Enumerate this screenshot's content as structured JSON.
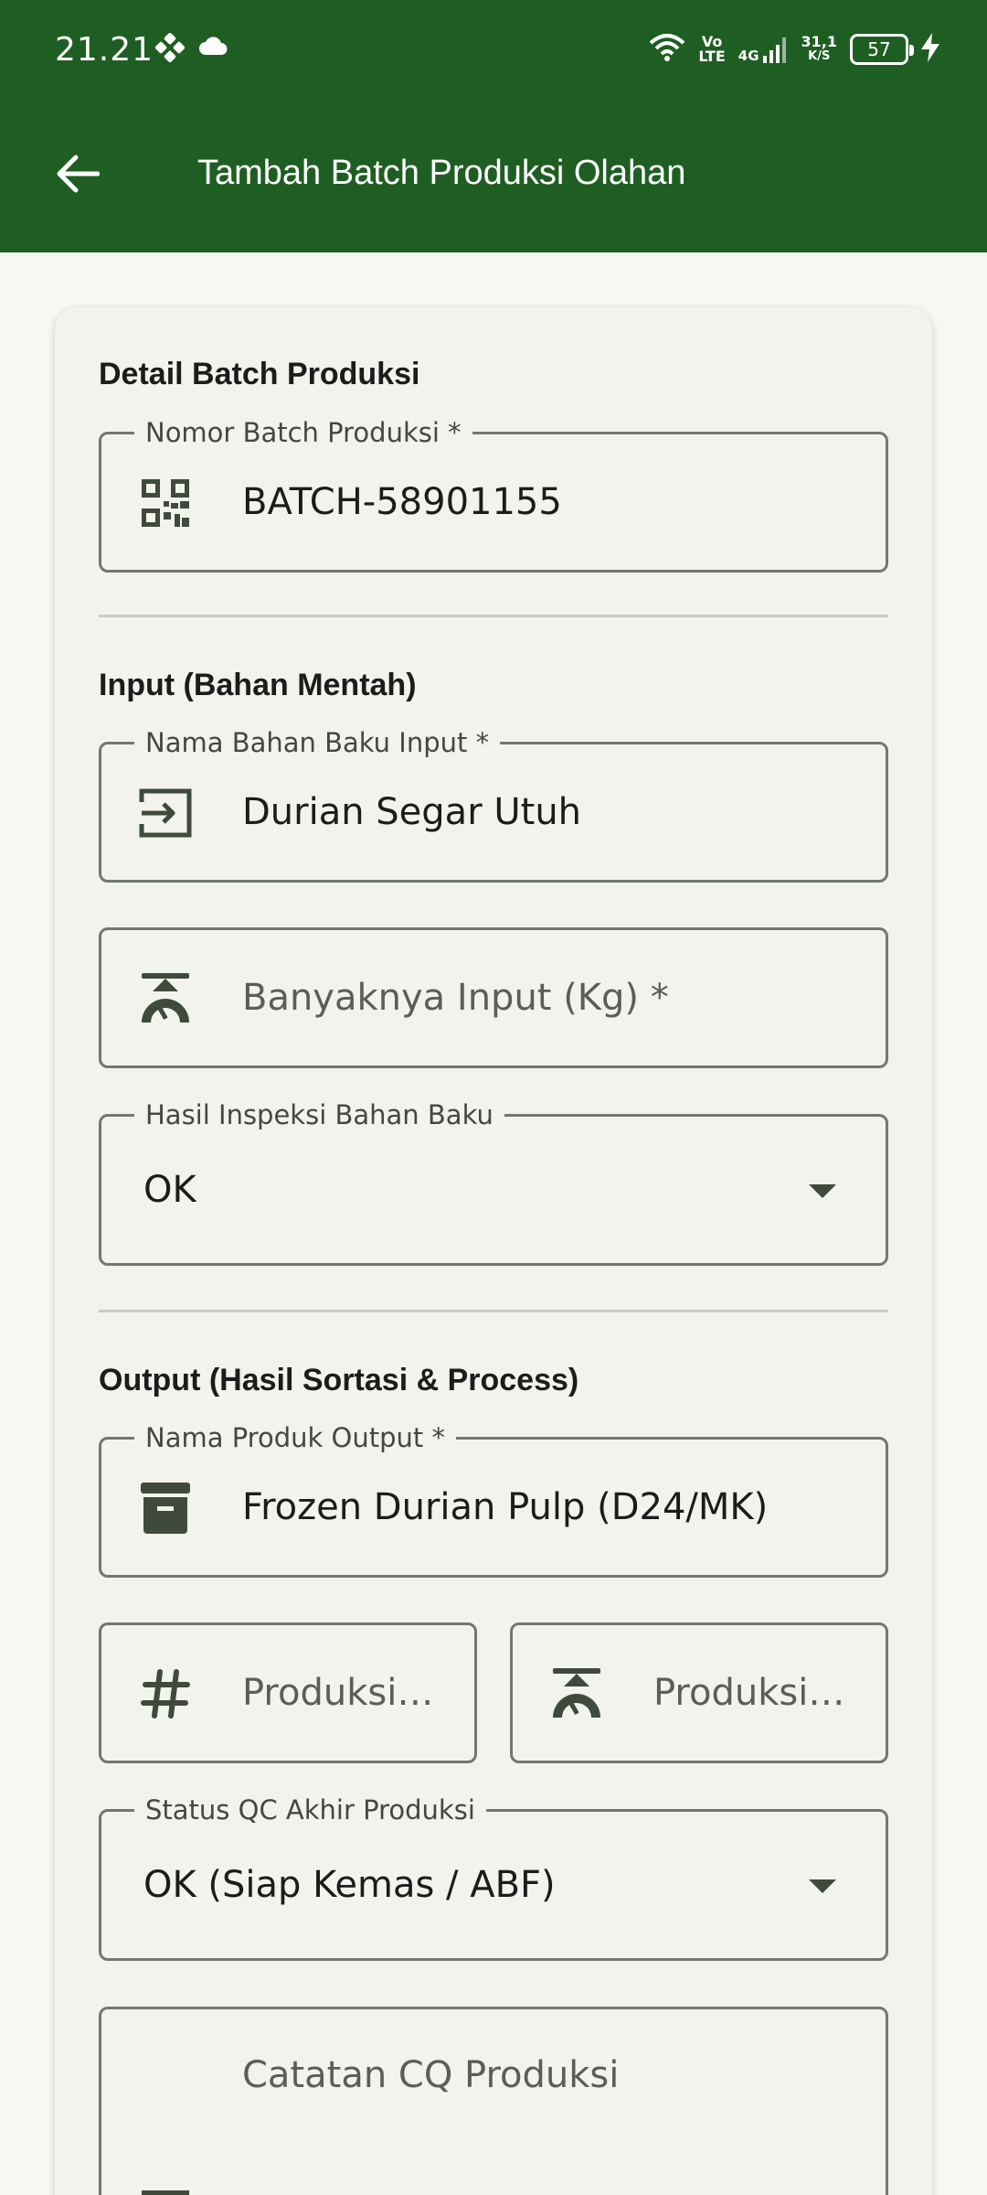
{
  "status_bar": {
    "time": "21.21",
    "volte": "Vo\nLTE",
    "network": "4G",
    "speed_value": "31,1",
    "speed_unit": "K/S",
    "battery": "57"
  },
  "app_bar": {
    "title": "Tambah Batch Produksi Olahan"
  },
  "form": {
    "section_batch": "Detail Batch Produksi",
    "batch_number": {
      "label": "Nomor Batch Produksi *",
      "value": "BATCH-58901155"
    },
    "section_input": "Input (Bahan Mentah)",
    "input_name": {
      "label": "Nama Bahan Baku Input *",
      "value": "Durian Segar Utuh"
    },
    "input_qty": {
      "placeholder": "Banyaknya Input (Kg) *"
    },
    "inspection": {
      "label": "Hasil Inspeksi Bahan Baku",
      "value": "OK"
    },
    "section_output": "Output (Hasil Sortasi & Process)",
    "output_name": {
      "label": "Nama Produk Output *",
      "value": "Frozen Durian Pulp (D24/MK)"
    },
    "output_count": {
      "placeholder": "Produksi…"
    },
    "output_weight": {
      "placeholder": "Produksi…"
    },
    "qc_status": {
      "label": "Status QC Akhir Produksi",
      "value": "OK (Siap Kemas / ABF)"
    },
    "qc_notes": {
      "placeholder": "Catatan CQ Produksi"
    }
  },
  "colors": {
    "primary": "#1f5e22",
    "surface": "#f1f3ec",
    "outline": "#72786e"
  },
  "icons": [
    "arrow-back-icon",
    "qr-code-icon",
    "login-icon",
    "scale-icon",
    "chevron-down-icon",
    "archive-box-icon",
    "hash-icon",
    "notes-icon"
  ]
}
